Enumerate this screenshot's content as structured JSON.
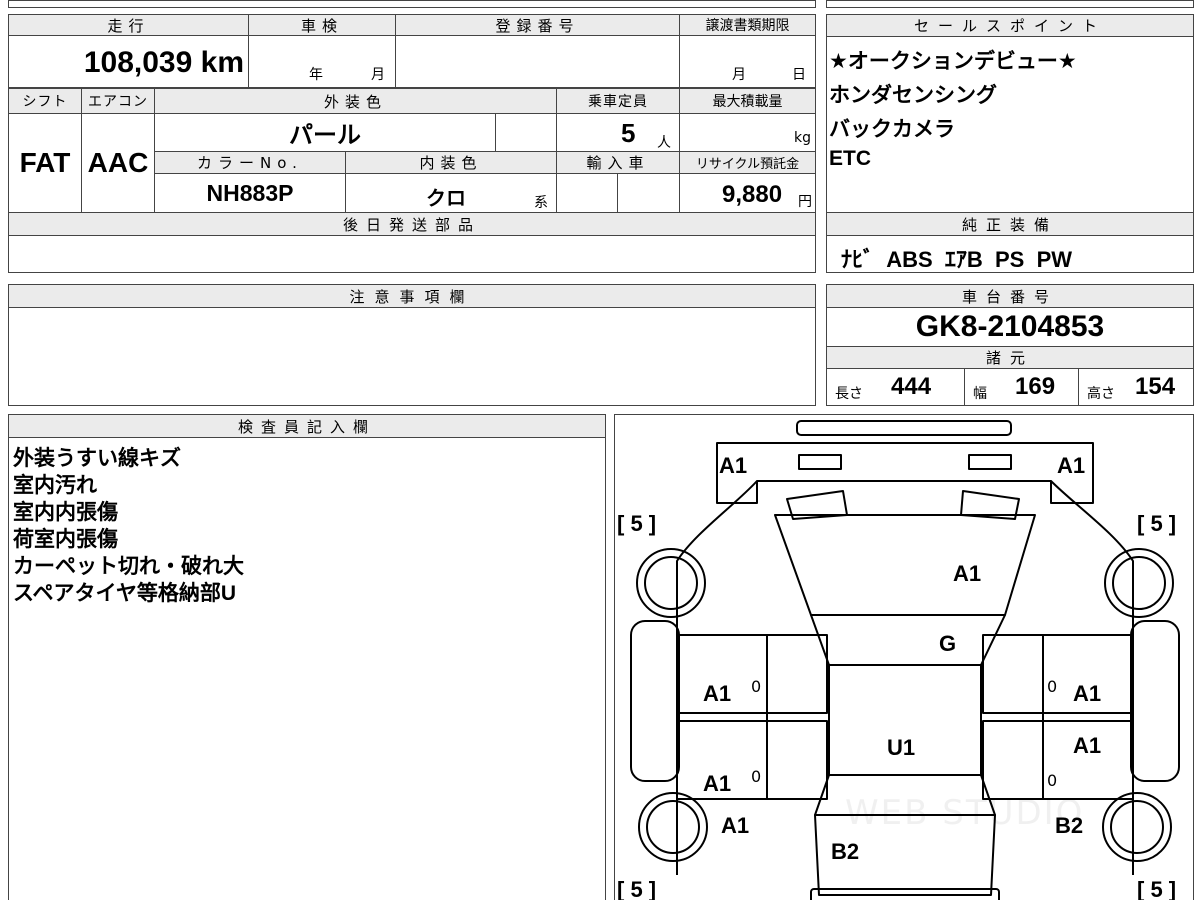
{
  "header": {
    "mileage_label": "走行",
    "inspection_label": "車検",
    "registration_label": "登録番号",
    "transfer_doc_label": "譲渡書類期限",
    "sales_points_label": "セールスポイント"
  },
  "row1": {
    "mileage_value": "108,039 km",
    "inspection_year_unit": "年",
    "inspection_month_unit": "月",
    "registration_value": "",
    "transfer_month_unit": "月",
    "transfer_day_unit": "日"
  },
  "row2_headers": {
    "shift": "シフト",
    "aircon": "エアコン",
    "exterior_color": "外装色",
    "capacity": "乗車定員",
    "max_load": "最大積載量"
  },
  "row2_values": {
    "shift": "FAT",
    "aircon": "AAC",
    "exterior_color": "パール",
    "capacity": "5",
    "capacity_unit": "人",
    "max_load_unit": "kg"
  },
  "row3_headers": {
    "color_no": "カラーNo.",
    "interior_color": "内装色",
    "import": "輸入車",
    "recycle": "リサイクル預託金"
  },
  "row3_values": {
    "color_no": "NH883P",
    "interior_color": "クロ",
    "interior_suffix": "系",
    "recycle_amount": "9,880",
    "recycle_unit": "円"
  },
  "later_parts_label": "後日発送部品",
  "later_parts_value": "",
  "sales_points": [
    "★オークションデビュー★",
    "ホンダセンシング",
    "バックカメラ",
    "ETC"
  ],
  "genuine_equipment_label": "純正装備",
  "genuine_equipment_value": "ﾅﾋﾞ  ABS  ｴｱB  PS  PW",
  "notes_label": "注意事項欄",
  "notes_value": "",
  "chassis_label": "車台番号",
  "chassis_value": "GK8-2104853",
  "specs_label": "諸元",
  "specs": {
    "length_label": "長さ",
    "length": "444",
    "width_label": "幅",
    "width": "169",
    "height_label": "高さ",
    "height": "154"
  },
  "inspector_label": "検査員記入欄",
  "inspector_notes": [
    "外装うすい線キズ",
    "室内汚れ",
    "室内内張傷",
    "荷室内張傷",
    "カーペット切れ・破れ大",
    "スペアタイヤ等格納部U"
  ],
  "diagram": {
    "tread_fl": "[ 5 ]",
    "tread_fr": "[ 5 ]",
    "tread_rl": "[ 5 ]",
    "tread_rr": "[ 5 ]",
    "front_bumper_left": "A1",
    "front_bumper_right": "A1",
    "hood": "A1",
    "windshield": "G",
    "front_door_left": "A1",
    "front_door_left_mark": "0",
    "front_door_right": "A1",
    "front_door_right_mark": "0",
    "rear_door_right": "A1",
    "rear_door_left": "A1",
    "rear_door_left_mark": "0",
    "rear_door_right_mark": "0",
    "roof": "U1",
    "rear_fender_left": "A1",
    "rear_fender_right": "B2",
    "rear_gate": "B2"
  },
  "watermark": "WEB STUDIO"
}
